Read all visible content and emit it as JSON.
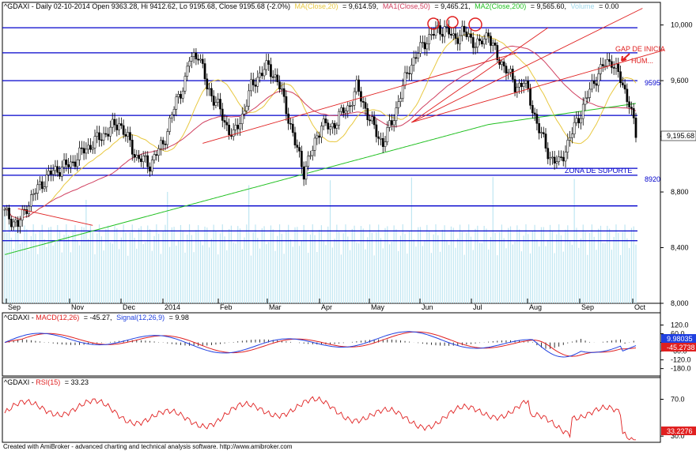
{
  "chart_data": {
    "type": "candlestick",
    "symbol": "^GDAXI",
    "header": {
      "prefix": "^GDAXI - Daily 02-10-2014 Open 9363.28, Hi 9412.62, Lo 9195.68, Close 9195.68 (-2.0%)",
      "ma20": "MA(Close,20)",
      "ma20_value": "= 9,614.59,",
      "ma50": "MA1(Close,50)",
      "ma50_value": "= 9,465.21,",
      "ma200": "MA2(Close,200)",
      "ma200_value": "= 9,565.60,",
      "volume": "Volume",
      "volume_value": "= 0.00"
    },
    "price_axis": {
      "ylim": [
        8000,
        10100
      ],
      "ticks": [
        "10,000",
        "9,600",
        "9,200",
        "8,800",
        "8,400",
        "8,000"
      ],
      "tick_values": [
        10000,
        9600,
        9200,
        8800,
        8400,
        8000
      ]
    },
    "x_tick_labels": [
      "Sep",
      "Nov",
      "Dec",
      "2014",
      "Feb",
      "Mar",
      "Apr",
      "May",
      "Jun",
      "Jul",
      "Aug",
      "Sep",
      "Oct"
    ],
    "last_price_label": "9,195.68",
    "level_labels": [
      "9595",
      "8920"
    ],
    "annotations": [
      "GAP DE INICIA",
      "HUM...",
      "ZONA DE SUPORTE"
    ],
    "colors": {
      "up": "#000000",
      "down": "#000000",
      "ma20": "#e8c840",
      "ma50": "#d04060",
      "ma200": "#20c020",
      "volume": "#bfe6f2",
      "levels": "#0000cc",
      "trend": "#e02020",
      "macd": "#2040e0",
      "signal": "#e02020",
      "rsi": "#e02020"
    },
    "macd_panel": {
      "title_prefix": "^GDAXI - ",
      "macd_label": "MACD(12,26)",
      "macd_value": "= -45.27,",
      "signal_label": "Signal(12,26,9)",
      "signal_value": "= 9.98",
      "ylim": [
        -220,
        150
      ],
      "ticks": [
        "120.0",
        "60.0",
        "0",
        "-60.0",
        "-120.0",
        "-180.0"
      ],
      "tick_values": [
        120,
        60,
        0,
        -60,
        -120,
        -180
      ],
      "last_signal": "9.98035",
      "last_macd": "-45.2738"
    },
    "rsi_panel": {
      "title_prefix": "^GDAXI - ",
      "rsi_label": "RSI(15)",
      "rsi_value": "= 33.23",
      "ylim": [
        25,
        85
      ],
      "ticks": [
        "70.0",
        "30.0"
      ],
      "tick_values": [
        70,
        30
      ],
      "last_rsi": "33.2276"
    },
    "footer": "Created with AmiBroker - advanced charting and technical analysis software. http://www.amibroker.com"
  }
}
